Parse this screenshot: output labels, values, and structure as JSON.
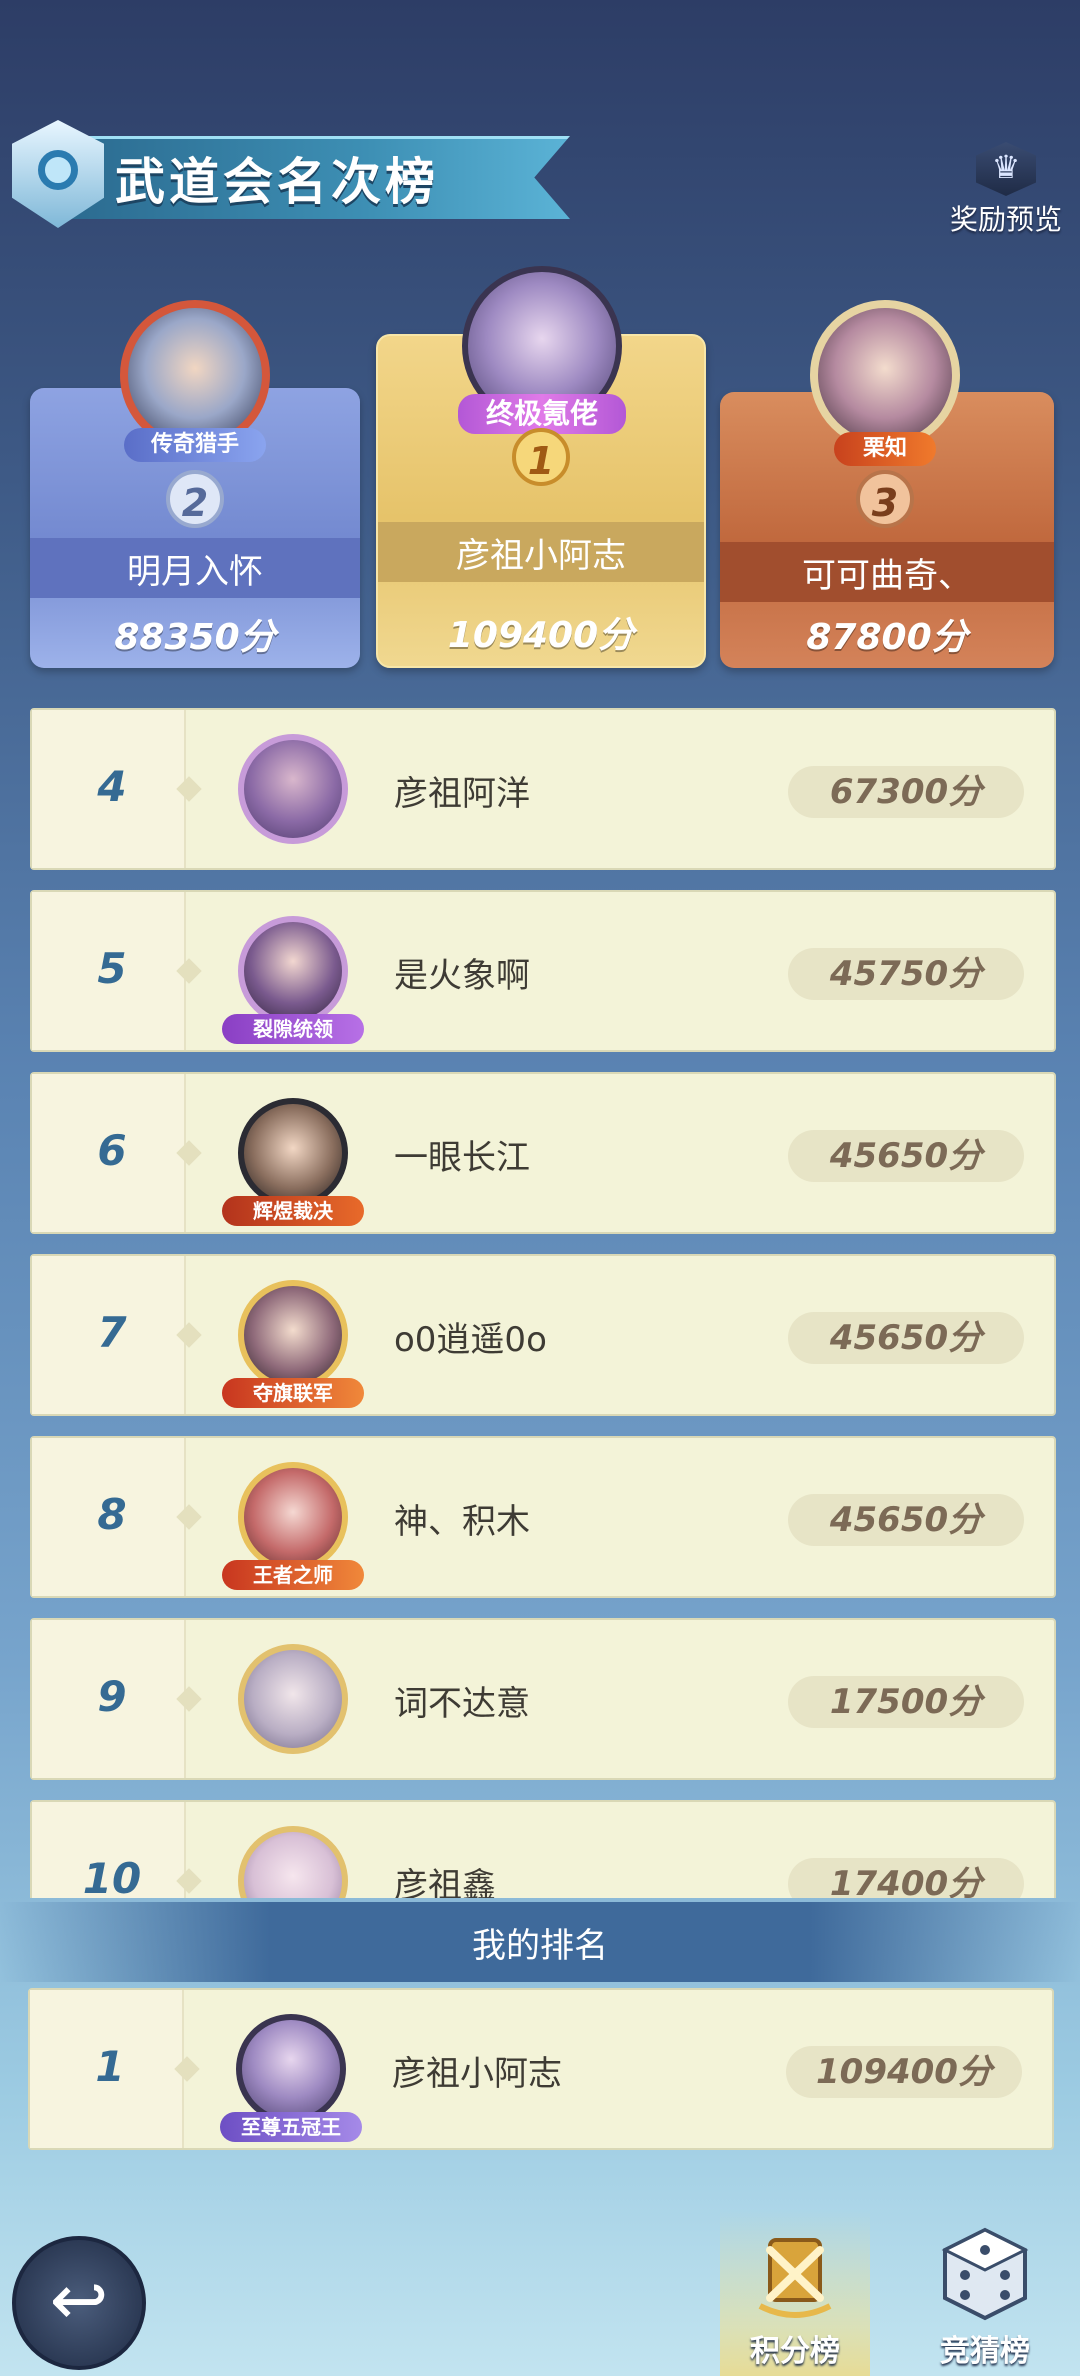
{
  "header": {
    "title": "武道会名次榜",
    "reward_preview": "奖励预览"
  },
  "podium": [
    {
      "rank": "1",
      "name": "彦祖小阿志",
      "score": "109400分",
      "tag": "终极氪佬"
    },
    {
      "rank": "2",
      "name": "明月入怀",
      "score": "88350分",
      "tag": "传奇猎手"
    },
    {
      "rank": "3",
      "name": "可可曲奇、",
      "score": "87800分",
      "tag": "栗知"
    }
  ],
  "rows": [
    {
      "rank": "4",
      "name": "彦祖阿洋",
      "score": "67300分",
      "badge": ""
    },
    {
      "rank": "5",
      "name": "是火象啊",
      "score": "45750分",
      "badge": "裂隙统领"
    },
    {
      "rank": "6",
      "name": "一眼长江",
      "score": "45650分",
      "badge": "辉煜裁决"
    },
    {
      "rank": "7",
      "name": "o0逍遥0o",
      "score": "45650分",
      "badge": "夺旗联军"
    },
    {
      "rank": "8",
      "name": "神、积木",
      "score": "45650分",
      "badge": "王者之师"
    },
    {
      "rank": "9",
      "name": "词不达意",
      "score": "17500分",
      "badge": ""
    },
    {
      "rank": "10",
      "name": "彦祖鑫",
      "score": "17400分",
      "badge": ""
    }
  ],
  "my_rank": {
    "title": "我的排名",
    "rank": "1",
    "name": "彦祖小阿志",
    "score": "109400分",
    "badge": "至尊五冠王"
  },
  "tabs": {
    "points": "积分榜",
    "guess": "竞猜榜"
  },
  "colors": {
    "rank_text": "#356a93",
    "row_bg": "#f3f3d8",
    "gold": "#d7b664"
  }
}
